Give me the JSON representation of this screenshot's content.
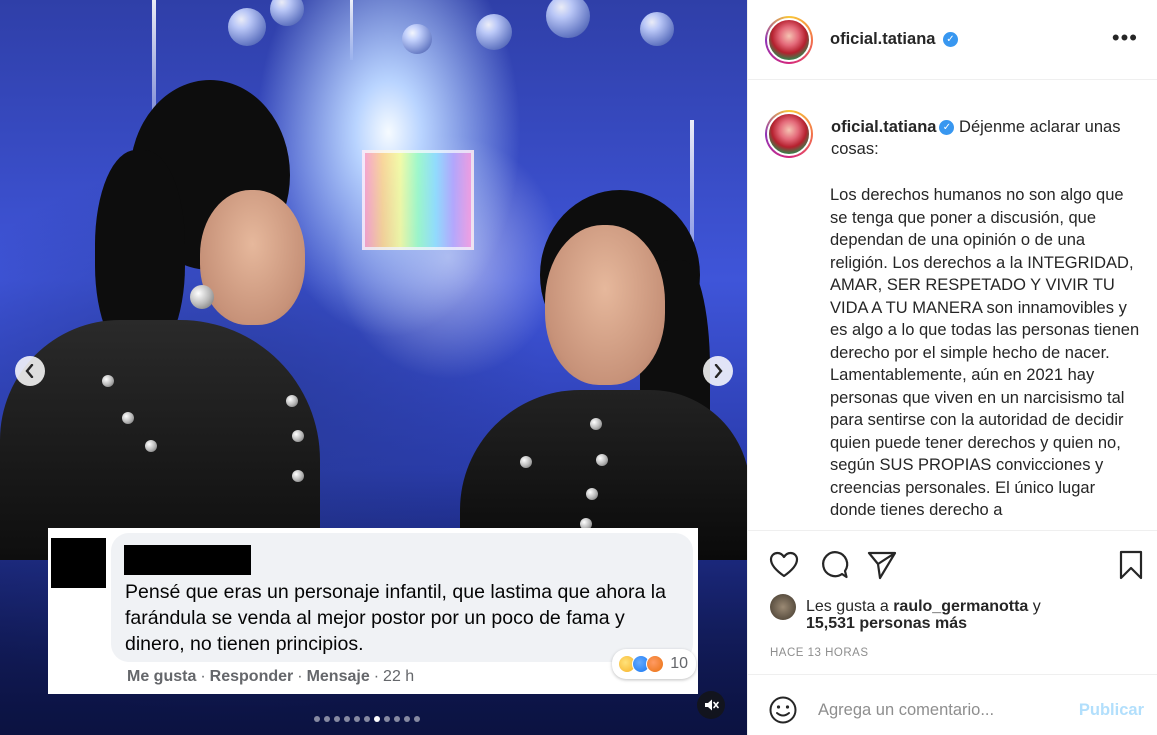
{
  "post": {
    "username": "oficial.tatiana",
    "caption_intro": "Déjenme aclarar unas cosas:",
    "caption_body": "Los derechos humanos no son algo que se tenga que poner a discusión, que dependan de una opinión o de una religión. Los derechos a la INTEGRIDAD, AMAR, SER RESPETADO Y VIVIR TU VIDA A TU MANERA son innamovibles y es algo a lo que todas las personas tienen derecho por el simple hecho de nacer. Lamentablemente, aún en 2021 hay personas que viven en un narcisismo tal para sentirse con la autoridad de decidir quien puede tener derechos y quien no, según SUS PROPIAS convicciones y creencias personales. El único lugar donde tienes derecho a",
    "likes_prefix": "Les gusta a",
    "liker": "raulo_germanotta",
    "likes_suffix": "y",
    "likes_count": "15,531 personas más",
    "time": "HACE 13 HORAS",
    "comment_placeholder": "Agrega un comentario...",
    "publish_label": "Publicar"
  },
  "media": {
    "prev_icon": "chevron-left-icon",
    "next_icon": "chevron-right-icon",
    "mute_icon": "speaker-muted-icon",
    "carousel_total": 11,
    "carousel_active_index": 6
  },
  "fb_comment": {
    "text": "Pensé que eras un personaje infantil, que lastima que ahora la farándula se venda al mejor postor por un poco de fama y dinero, no tienen principios.",
    "reaction_count": "10",
    "action_like": "Me gusta",
    "action_reply": "Responder",
    "action_message": "Mensaje",
    "time": "22 h",
    "separator": "·"
  },
  "colors": {
    "verified": "#3897f0",
    "publish": "#b2dffc",
    "muted_text": "#8e8e8e"
  }
}
